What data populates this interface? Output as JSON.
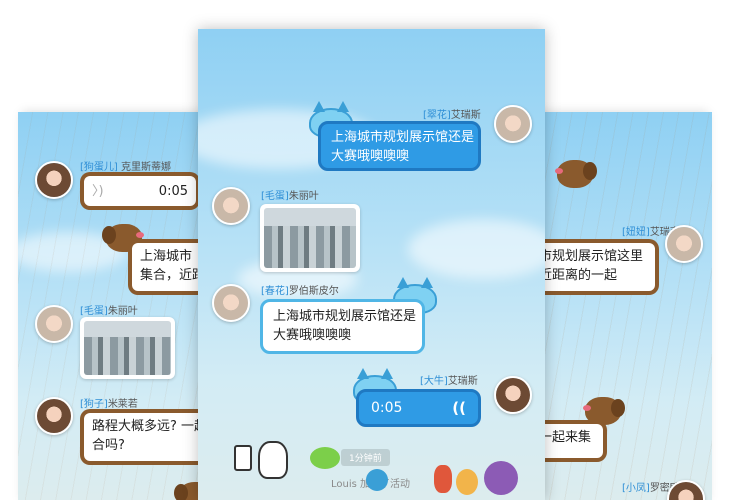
{
  "left": {
    "msg1": {
      "tag": "[狗蛋儿]",
      "name": "克里斯蒂娜",
      "duration": "0:05"
    },
    "msg2": {
      "text": "上海城市规划展示馆还是大赛哦噢噢噢",
      "visible": "上海城市\n集合，近距"
    },
    "msg3": {
      "tag": "[毛蛋]",
      "name": "朱丽叶"
    },
    "msg4": {
      "tag": "[狗子]",
      "name": "米莱若",
      "text": "路程大概多远? 一起\n合吗?"
    }
  },
  "center": {
    "msg1": {
      "tag": "[翠花]",
      "name": "艾瑞斯",
      "text": "上海城市规划展示馆还是\n大赛哦噢噢噢"
    },
    "msg2": {
      "tag": "[毛蛋]",
      "name": "朱丽叶"
    },
    "msg3": {
      "tag": "[春花]",
      "name": "罗伯斯皮尔",
      "text": "上海城市规划展示馆还是\n大赛哦噢噢噢"
    },
    "msg4": {
      "tag": "[大牛]",
      "name": "艾瑞斯",
      "duration": "0:05"
    },
    "timestamp": "1分钟前",
    "system": "Louis 加入了活动"
  },
  "right": {
    "msg1": {
      "tag": "[妞妞]",
      "name": "艾瑞克",
      "text": "市规划展示馆这里\n近距离的一起"
    },
    "msg2": {
      "text": "一起来集"
    },
    "msg3": {
      "tag": "[小凤]",
      "name": "罗密欧"
    }
  },
  "colors": {
    "blue_bubble": "#2f9be5",
    "brown_bubble": "#8a5a2d",
    "tag": "#2f8fd6"
  }
}
